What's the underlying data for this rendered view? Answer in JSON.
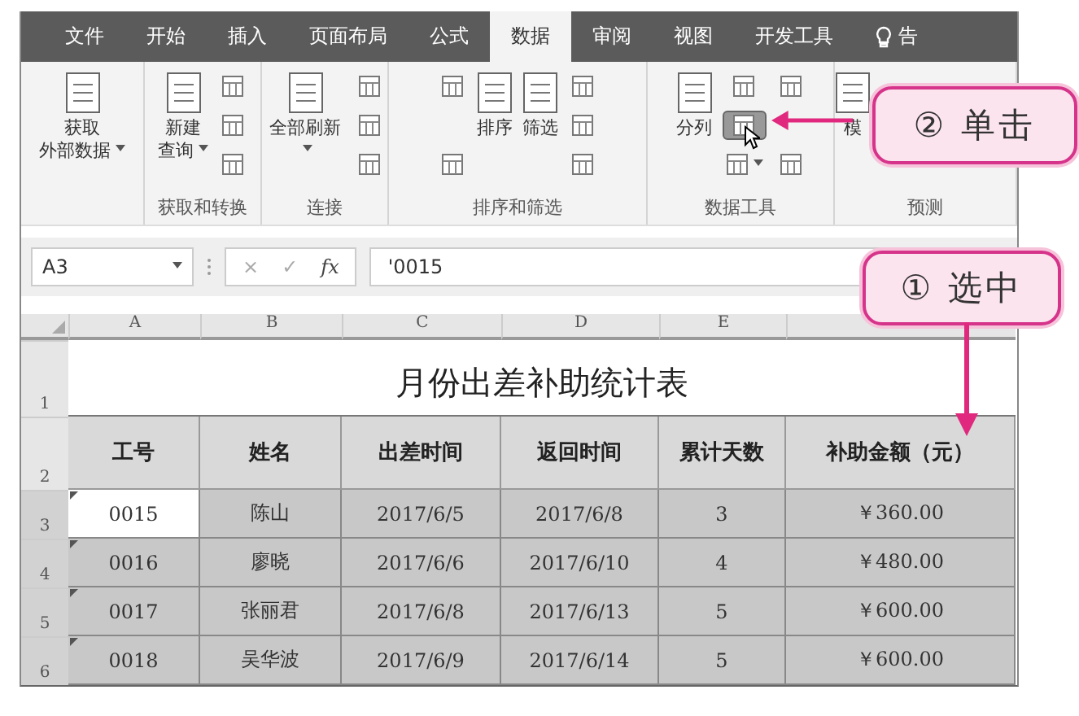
{
  "tabs": [
    {
      "label": "文件",
      "selected": false
    },
    {
      "label": "开始",
      "selected": false
    },
    {
      "label": "插入",
      "selected": false
    },
    {
      "label": "页面布局",
      "selected": false
    },
    {
      "label": "公式",
      "selected": false
    },
    {
      "label": "数据",
      "selected": true
    },
    {
      "label": "审阅",
      "selected": false
    },
    {
      "label": "视图",
      "selected": false
    },
    {
      "label": "开发工具",
      "selected": false
    },
    {
      "label": "告",
      "selected": false
    }
  ],
  "ribbon": {
    "groups": [
      {
        "items": [
          {
            "kind": "large",
            "lines": [
              "获取",
              "外部数据"
            ],
            "dropdown": true
          }
        ]
      },
      {
        "label": "获取和转换",
        "items": [
          {
            "kind": "large",
            "lines": [
              "新建",
              "查询"
            ],
            "dropdown": true
          },
          {
            "kind": "stack",
            "icons": [
              {
                "dropdown": false,
                "hovered": false
              },
              {
                "dropdown": false,
                "hovered": false
              },
              {
                "dropdown": false,
                "hovered": false
              }
            ]
          }
        ]
      },
      {
        "label": "连接",
        "items": [
          {
            "kind": "large",
            "lines": [
              "全部刷新"
            ],
            "dropdown": true
          },
          {
            "kind": "stack",
            "icons": [
              {
                "dropdown": false,
                "hovered": false
              },
              {
                "dropdown": false,
                "hovered": false
              },
              {
                "dropdown": false,
                "hovered": false
              }
            ]
          }
        ]
      },
      {
        "label": "排序和筛选",
        "items": [
          {
            "kind": "stack",
            "icons": [
              {
                "dropdown": false,
                "hovered": false
              },
              {
                "dropdown": false,
                "hovered": false
              }
            ]
          },
          {
            "kind": "large",
            "lines": [
              "排序"
            ],
            "dropdown": false
          },
          {
            "kind": "large",
            "lines": [
              "筛选"
            ],
            "dropdown": false
          },
          {
            "kind": "stack",
            "icons": [
              {
                "dropdown": false,
                "hovered": false
              },
              {
                "dropdown": false,
                "hovered": false
              },
              {
                "dropdown": false,
                "hovered": false
              }
            ]
          }
        ]
      },
      {
        "label": "数据工具",
        "items": [
          {
            "kind": "large",
            "lines": [
              "分列"
            ],
            "dropdown": false
          },
          {
            "kind": "stack",
            "icons": [
              {
                "dropdown": false,
                "hovered": false
              },
              {
                "dropdown": false,
                "hovered": true
              },
              {
                "dropdown": true,
                "hovered": false
              }
            ]
          },
          {
            "kind": "stack",
            "icons": [
              {
                "dropdown": false,
                "hovered": false
              },
              {
                "dropdown": false,
                "hovered": false
              }
            ]
          }
        ]
      },
      {
        "label": "预测",
        "items": [
          {
            "kind": "large",
            "lines": [
              "模"
            ],
            "dropdown": false
          }
        ]
      }
    ]
  },
  "formula_bar": {
    "name_box": "A3",
    "cancel_glyph": "×",
    "enter_glyph": "✓",
    "fx_label": "fx",
    "value": "'0015"
  },
  "sheet": {
    "columns": [
      "A",
      "B",
      "C",
      "D",
      "E"
    ],
    "title_row": {
      "row": "1",
      "text": "月份出差补助统计表"
    },
    "header_row": {
      "row": "2",
      "cells": [
        "工号",
        "姓名",
        "出差时间",
        "返回时间",
        "累计天数",
        "补助金额（元）"
      ]
    },
    "rows": [
      {
        "row": "3",
        "selected": true,
        "cells": [
          {
            "text": "0015",
            "active": true,
            "flagged": true
          },
          {
            "text": "陈山",
            "active": false,
            "flagged": false
          },
          {
            "text": "2017/6/5",
            "active": false,
            "flagged": false
          },
          {
            "text": "2017/6/8",
            "active": false,
            "flagged": false
          },
          {
            "text": "3",
            "active": false,
            "flagged": false
          },
          {
            "text": "￥360.00",
            "active": false,
            "flagged": false
          }
        ]
      },
      {
        "row": "4",
        "selected": true,
        "cells": [
          {
            "text": "0016",
            "active": false,
            "flagged": true
          },
          {
            "text": "廖晓",
            "active": false,
            "flagged": false
          },
          {
            "text": "2017/6/6",
            "active": false,
            "flagged": false
          },
          {
            "text": "2017/6/10",
            "active": false,
            "flagged": false
          },
          {
            "text": "4",
            "active": false,
            "flagged": false
          },
          {
            "text": "￥480.00",
            "active": false,
            "flagged": false
          }
        ]
      },
      {
        "row": "5",
        "selected": true,
        "cells": [
          {
            "text": "0017",
            "active": false,
            "flagged": true
          },
          {
            "text": "张丽君",
            "active": false,
            "flagged": false
          },
          {
            "text": "2017/6/8",
            "active": false,
            "flagged": false
          },
          {
            "text": "2017/6/13",
            "active": false,
            "flagged": false
          },
          {
            "text": "5",
            "active": false,
            "flagged": false
          },
          {
            "text": "￥600.00",
            "active": false,
            "flagged": false
          }
        ]
      },
      {
        "row": "6",
        "selected": true,
        "cells": [
          {
            "text": "0018",
            "active": false,
            "flagged": true
          },
          {
            "text": "吴华波",
            "active": false,
            "flagged": false
          },
          {
            "text": "2017/6/9",
            "active": false,
            "flagged": false
          },
          {
            "text": "2017/6/14",
            "active": false,
            "flagged": false
          },
          {
            "text": "5",
            "active": false,
            "flagged": false
          },
          {
            "text": "￥600.00",
            "active": false,
            "flagged": false
          }
        ]
      }
    ]
  },
  "callouts": [
    {
      "kind": "click",
      "text": "② 单击"
    },
    {
      "kind": "select",
      "text": "① 选中"
    }
  ]
}
